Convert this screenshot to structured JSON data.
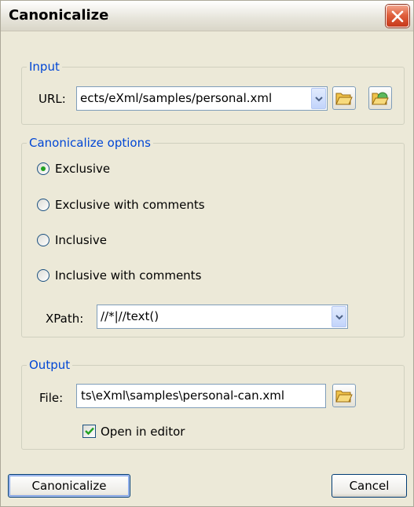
{
  "window": {
    "title": "Canonicalize"
  },
  "input": {
    "legend": "Input",
    "url_label": "URL:",
    "url_value": "ects/eXml/samples/personal.xml"
  },
  "options": {
    "legend": "Canonicalize options",
    "radios": [
      {
        "label": "Exclusive",
        "checked": true
      },
      {
        "label": "Exclusive with comments",
        "checked": false
      },
      {
        "label": "Inclusive",
        "checked": false
      },
      {
        "label": "Inclusive with comments",
        "checked": false
      }
    ],
    "xpath_label": "XPath:",
    "xpath_value": "//*|//text()"
  },
  "output": {
    "legend": "Output",
    "file_label": "File:",
    "file_value": "ts\\eXml\\samples\\personal-can.xml",
    "open_in_editor_label": "Open in editor",
    "open_in_editor_checked": true
  },
  "buttons": {
    "canonicalize": "Canonicalize",
    "cancel": "Cancel"
  },
  "icons": {
    "close": "close-x-icon",
    "open_folder": "open-folder-icon",
    "open_folder_green": "open-folder-green-icon",
    "dropdown": "chevron-down-icon",
    "checkmark": "checkmark-icon"
  },
  "colors": {
    "legend": "#0046d5",
    "radio_dot": "#21a121",
    "check": "#21a121",
    "close_button": "#e0603d"
  }
}
